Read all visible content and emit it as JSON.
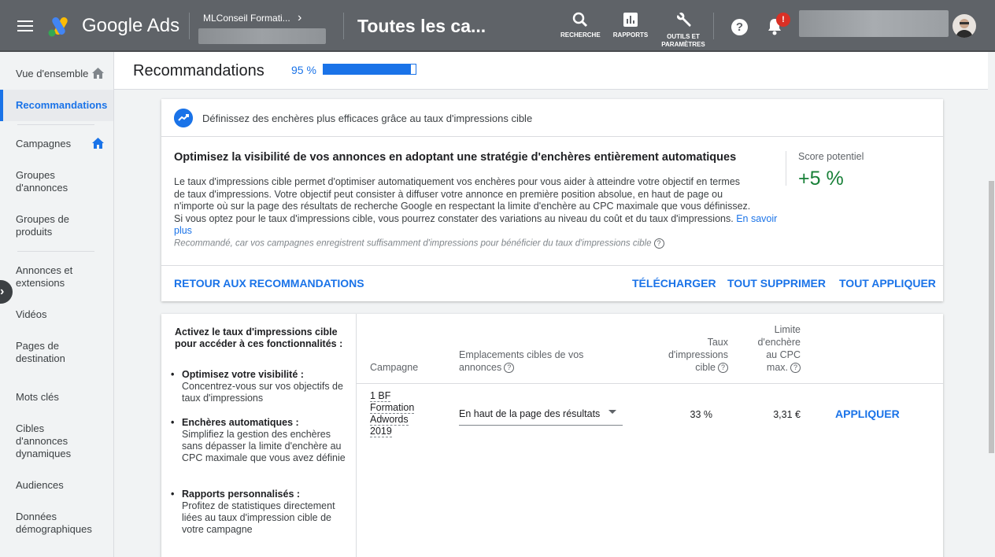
{
  "header": {
    "brand": "Google Ads",
    "account_name": "MLConseil Formati...",
    "page_title": "Toutes les ca...",
    "tools": {
      "search": "RECHERCHE",
      "reports": "RAPPORTS",
      "tools_line1": "OUTILS ET",
      "tools_line2": "PARAMÈTRES"
    },
    "notification_badge": "!"
  },
  "sidebar": {
    "items": [
      {
        "label": "Vue d'ensemble",
        "icon": "home-icon"
      },
      {
        "label": "Recommandations"
      },
      {
        "label": "Campagnes",
        "icon": "home-icon"
      },
      {
        "label": "Groupes d'annonces"
      },
      {
        "label": "Groupes de produits"
      },
      {
        "label": "Annonces et extensions"
      },
      {
        "label": "Vidéos"
      },
      {
        "label": "Pages de destination"
      },
      {
        "label": "Mots clés"
      },
      {
        "label": "Cibles d'annonces dynamiques"
      },
      {
        "label": "Audiences"
      },
      {
        "label": "Données démographiques"
      }
    ]
  },
  "recommendations": {
    "title": "Recommandations",
    "score_label": "95 %",
    "score_fraction": 0.95
  },
  "card": {
    "header": "Définissez des enchères plus efficaces grâce au taux d'impressions cible",
    "title": "Optimisez la visibilité de vos annonces en adoptant une stratégie d'enchères entièrement automatiques",
    "desc_line1": "Le taux d'impressions cible permet d'optimiser automatiquement vos enchères pour vous aider à atteindre votre objectif en termes",
    "desc_line2": "de taux d'impressions. Votre objectif peut consister à diffuser votre annonce en première position absolue, en haut de page ou",
    "desc_line3": "n'importe où sur la page des résultats de recherche Google en respectant la limite d'enchère au CPC maximale que vous définissez.",
    "desc_line4": "Si vous optez pour le taux d'impressions cible, vous pourrez constater des variations au niveau du coût et du taux d'impressions.",
    "learn_more": "En savoir plus",
    "score_label": "Score potentiel",
    "score_value": "+5 %",
    "reason": "Recommandé, car vos campagnes enregistrent suffisamment d'impressions pour bénéficier du taux d'impressions cible",
    "actions": {
      "back": "RETOUR AUX RECOMMANDATIONS",
      "download": "TÉLÉCHARGER",
      "delete_all": "TOUT SUPPRIMER",
      "apply_all": "TOUT APPLIQUER"
    }
  },
  "features": {
    "title": "Activez le taux d'impressions cible pour accéder à ces fonctionnalités :",
    "items": [
      {
        "bold": "Optimisez votre visibilité :",
        "text": "Concentrez-vous sur vos objectifs de taux d'impressions"
      },
      {
        "bold": "Enchères automatiques :",
        "text": "Simplifiez la gestion des enchères sans dépasser la limite d'enchère au CPC maximale que vous avez définie"
      },
      {
        "bold": "Rapports personnalisés :",
        "text": "Profitez de statistiques directement liées au taux d'impression cible de votre campagne"
      }
    ]
  },
  "table": {
    "headers": {
      "campaign": "Campagne",
      "placement_l1": "Emplacements cibles de vos",
      "placement_l2": "annonces",
      "rate_l1": "Taux",
      "rate_l2": "d'impressions",
      "rate_l3": "cible",
      "cpc_l1": "Limite",
      "cpc_l2": "d'enchère",
      "cpc_l3": "au CPC",
      "cpc_l4": "max."
    },
    "rows": [
      {
        "campaign_l1": "1 BF",
        "campaign_l2": "Formation",
        "campaign_l3": "Adwords",
        "campaign_l4": "2019",
        "placement": "En haut de la page des résultats",
        "rate": "33 %",
        "cpc": "3,31 €",
        "action": "APPLIQUER"
      }
    ]
  }
}
